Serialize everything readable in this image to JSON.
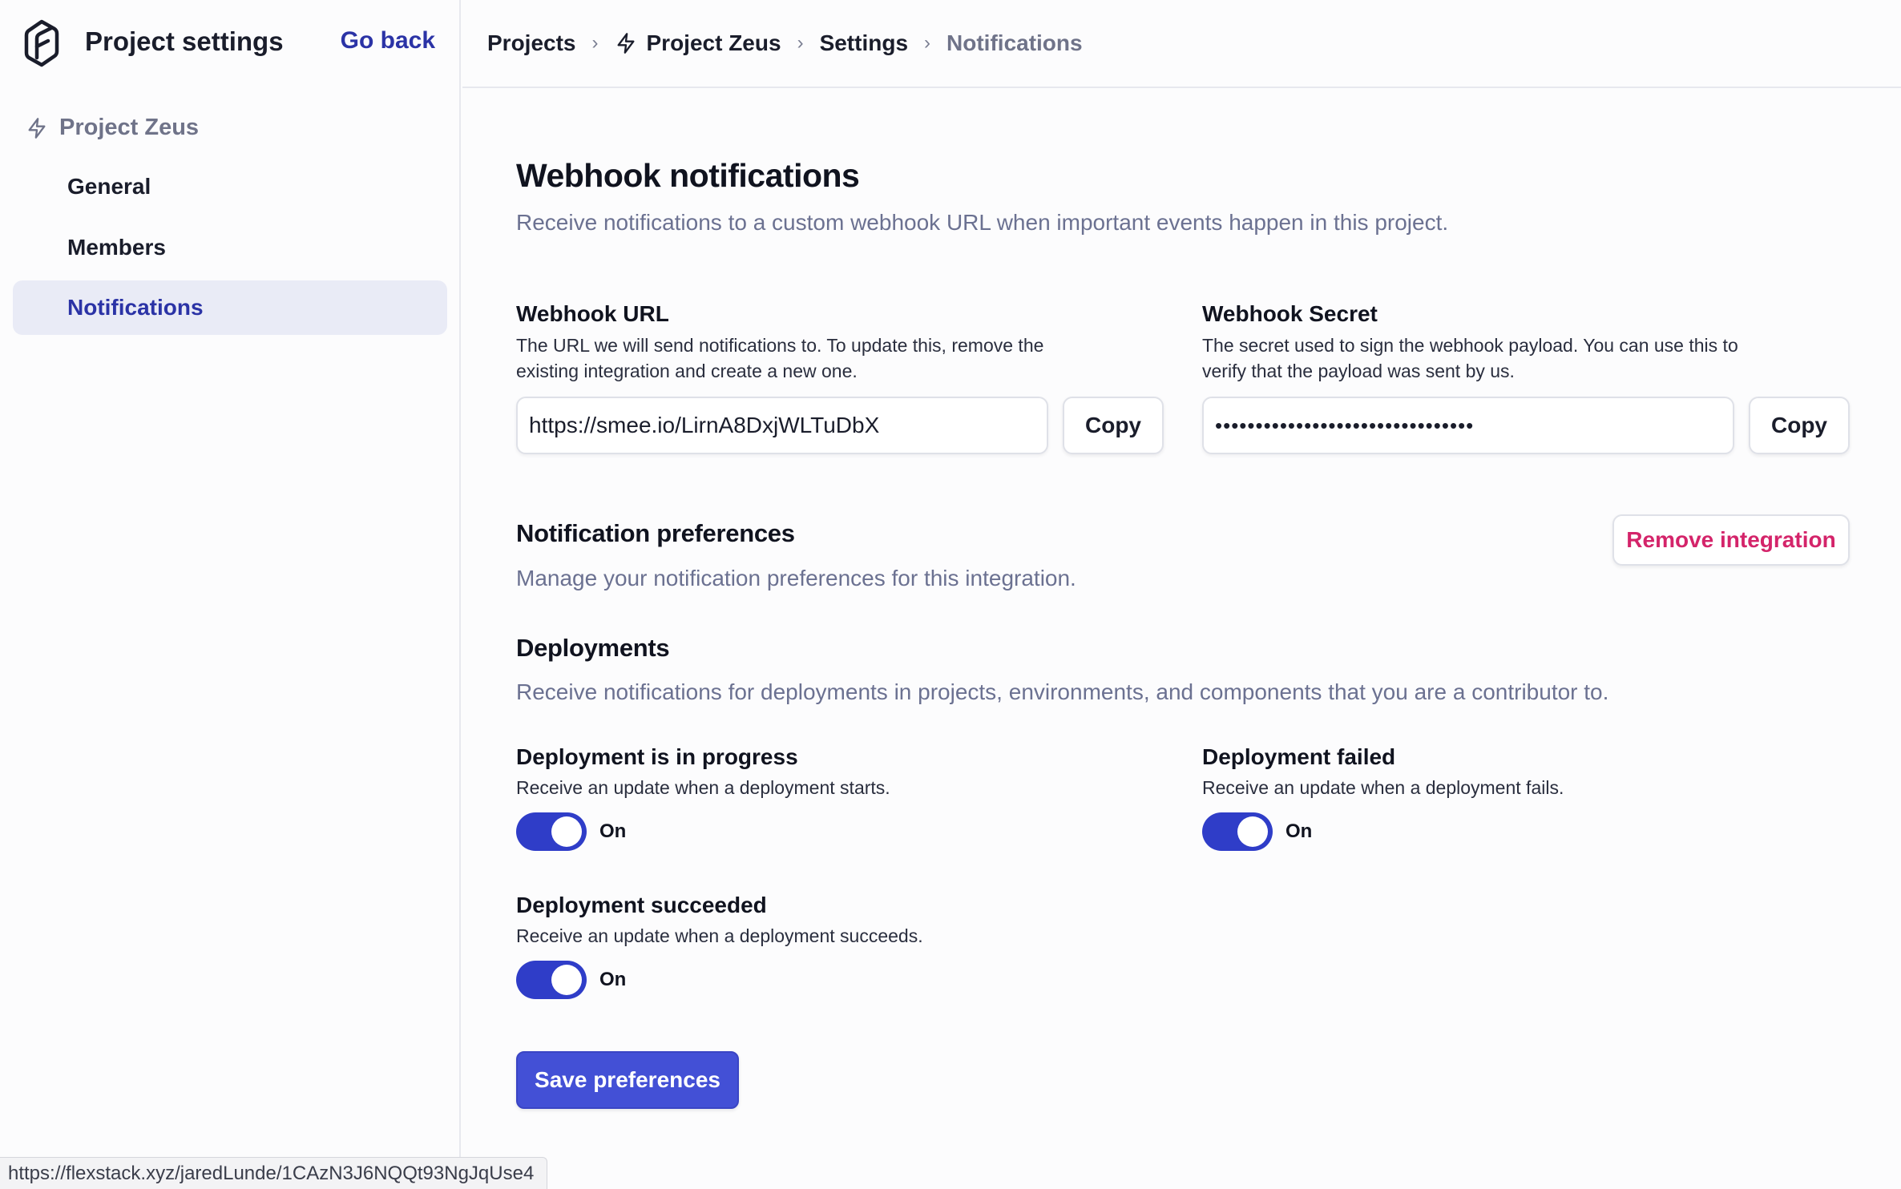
{
  "sidebar": {
    "title": "Project settings",
    "go_back": "Go back",
    "project_name": "Project Zeus",
    "items": [
      {
        "label": "General",
        "active": false
      },
      {
        "label": "Members",
        "active": false
      },
      {
        "label": "Notifications",
        "active": true
      }
    ]
  },
  "breadcrumb": {
    "items": [
      "Projects",
      "Project Zeus",
      "Settings",
      "Notifications"
    ],
    "separator": "›"
  },
  "webhook": {
    "title": "Webhook notifications",
    "description": "Receive notifications to a custom webhook URL when important events happen in this project.",
    "url": {
      "label": "Webhook URL",
      "description": "The URL we will send notifications to. To update this, remove the existing integration and create a new one.",
      "value": "https://smee.io/LirnA8DxjWLTuDbX",
      "copy_label": "Copy"
    },
    "secret": {
      "label": "Webhook Secret",
      "description": "The secret used to sign the webhook payload. You can use this to verify that the payload was sent by us.",
      "value": "••••••••••••••••••••••••••••••••",
      "copy_label": "Copy"
    }
  },
  "preferences": {
    "title": "Notification preferences",
    "description": "Manage your notification preferences for this integration.",
    "remove_label": "Remove integration",
    "deployments": {
      "title": "Deployments",
      "description": "Receive notifications for deployments in projects, environments, and components that you are a contributor to.",
      "items": [
        {
          "title": "Deployment is in progress",
          "description": "Receive an update when a deployment starts.",
          "state": "On"
        },
        {
          "title": "Deployment failed",
          "description": "Receive an update when a deployment fails.",
          "state": "On"
        },
        {
          "title": "Deployment succeeded",
          "description": "Receive an update when a deployment succeeds.",
          "state": "On"
        }
      ]
    },
    "save_label": "Save preferences"
  },
  "status_bar": {
    "url": "https://flexstack.xyz/jaredLunde/1CAzN3J6NQQt93NgJqUse4"
  },
  "colors": {
    "accent": "#2f3dc8",
    "link": "#2b33a6",
    "danger": "#d4246a",
    "muted": "#6b7191"
  },
  "icons": {
    "logo": "flexstack-logo-icon",
    "project": "lightning-bolt-icon"
  }
}
